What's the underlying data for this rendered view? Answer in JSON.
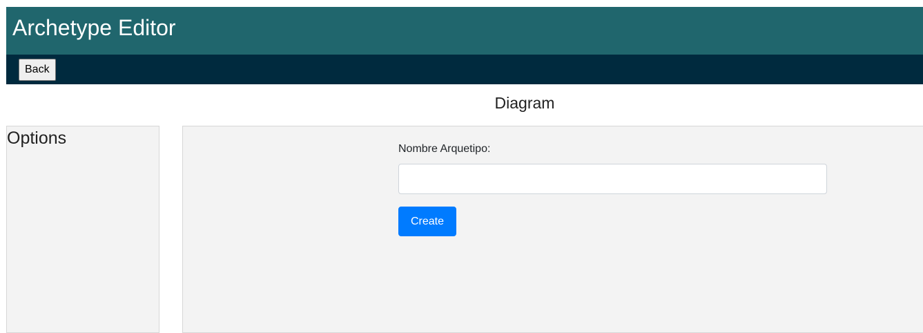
{
  "header": {
    "title": "Archetype Editor"
  },
  "toolbar": {
    "back_label": "Back"
  },
  "diagram": {
    "heading": "Diagram"
  },
  "options_panel": {
    "title": "Options"
  },
  "form": {
    "name_label": "Nombre Arquetipo:",
    "name_value": "",
    "name_placeholder": "",
    "create_label": "Create"
  },
  "colors": {
    "header_bg": "#20666d",
    "toolbar_bg": "#002a3e",
    "panel_bg": "#f3f3f3",
    "primary_button": "#007bff"
  }
}
